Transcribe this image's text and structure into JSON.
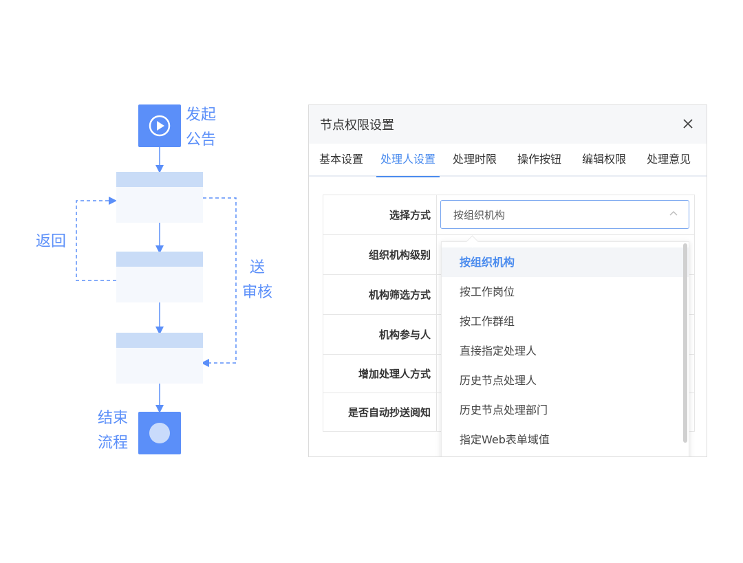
{
  "flow": {
    "start_label_line1": "发起",
    "start_label_line2": "公告",
    "end_label_line1": "结束",
    "end_label_line2": "流程",
    "return_label": "返回",
    "send_label_line1": "送",
    "send_label_line2": "审核",
    "accent_color": "#5b8ff9"
  },
  "dialog": {
    "title": "节点权限设置",
    "close_icon": "close-icon",
    "tabs": [
      {
        "label": "基本设置",
        "active": false
      },
      {
        "label": "处理人设置",
        "active": true
      },
      {
        "label": "处理时限",
        "active": false
      },
      {
        "label": "操作按钮",
        "active": false
      },
      {
        "label": "编辑权限",
        "active": false
      },
      {
        "label": "处理意见",
        "active": false
      }
    ],
    "form_rows": [
      {
        "label": "选择方式"
      },
      {
        "label": "组织机构级别"
      },
      {
        "label": "机构筛选方式"
      },
      {
        "label": "机构参与人"
      },
      {
        "label": "增加处理人方式"
      },
      {
        "label": "是否自动抄送阅知"
      }
    ],
    "select": {
      "value": "按组织机构",
      "caret_icon": "chevron-up-icon"
    },
    "dropdown_options": [
      {
        "label": "按组织机构",
        "selected": true
      },
      {
        "label": "按工作岗位",
        "selected": false
      },
      {
        "label": "按工作群组",
        "selected": false
      },
      {
        "label": "直接指定处理人",
        "selected": false
      },
      {
        "label": "历史节点处理人",
        "selected": false
      },
      {
        "label": "历史节点处理部门",
        "selected": false
      },
      {
        "label": "指定Web表单域值",
        "selected": false
      }
    ],
    "active_tab_color": "#4a8bee"
  }
}
